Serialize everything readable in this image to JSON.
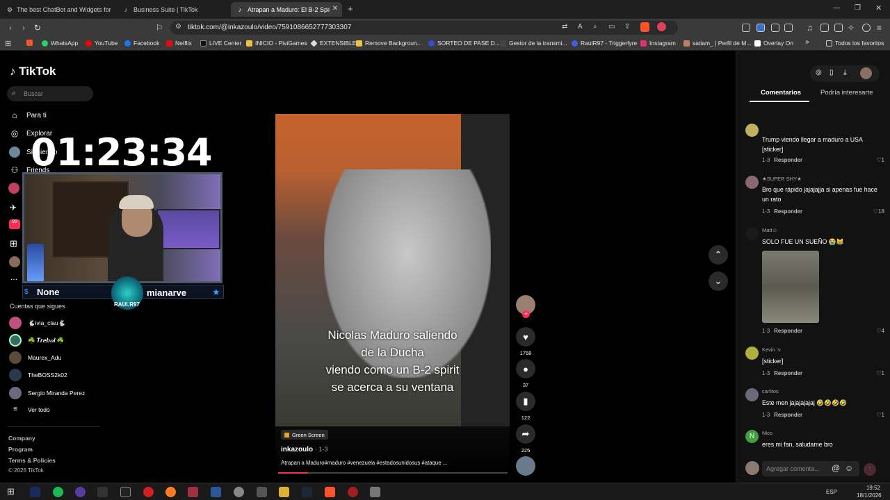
{
  "browser": {
    "tabs": [
      {
        "label": "The best ChatBot and Widgets for Ki",
        "icon": "gear-icon"
      },
      {
        "label": "Business Suite | TikTok",
        "icon": "tiktok-icon"
      },
      {
        "label": "Atrapan a Maduro: El B-2 Spirit",
        "icon": "tiktok-icon"
      }
    ],
    "new_tab": "+",
    "url": "tiktok.com/@inkazoulo/video/7591086652777303307",
    "bookmarks": [
      {
        "label": "WhatsApp",
        "color": "#25d366"
      },
      {
        "label": "YouTube",
        "color": "#ff0000"
      },
      {
        "label": "Facebook",
        "color": "#1877f2"
      },
      {
        "label": "Netflix",
        "color": "#e50914"
      },
      {
        "label": "LIVE Center",
        "color": "#111111"
      },
      {
        "label": "INICIO - PiviGames",
        "color": "#f0c040"
      },
      {
        "label": "EXTENSIBLE",
        "color": "#dddddd"
      },
      {
        "label": "Remove Backgroun...",
        "color": "#f0c040"
      },
      {
        "label": "SORTEO DE PASE D...",
        "color": "#3050d0"
      },
      {
        "label": "Gestor de la transmi...",
        "color": "#444444"
      },
      {
        "label": "RaulR97 - Triggerfyre",
        "color": "#4060e0"
      },
      {
        "label": "Instagram",
        "color": "#e1306c"
      },
      {
        "label": "satiam_ | Perfil de M...",
        "color": "#c08060"
      },
      {
        "label": "Overlay On",
        "color": "#ffffff"
      }
    ],
    "bookmarks_more": "»",
    "all_bookmarks": "Todos los favoritos"
  },
  "tiktok": {
    "logo": "TikTok",
    "search_placeholder": "Buscar",
    "nav": [
      "Para ti",
      "Explorar",
      "Siguiendo",
      "Friends"
    ],
    "nav_more": "...",
    "following_header": "Cuentas que sigues",
    "following": [
      "🐇ivia_clau🐇",
      "☘️ 𝑻𝒓𝒆𝒃𝒐𝒍 ☘️",
      "Maurex_Adu",
      "TheBOSS2k02",
      "Sergio Miranda Perez"
    ],
    "see_all": "Ver todo",
    "footer": [
      "Company",
      "Program",
      "Terms & Policies",
      "© 2026 TikTok"
    ]
  },
  "stream_overlay": {
    "timer": "01:23:34",
    "left_label": "None",
    "right_label": "mianarve",
    "emblem": "RAULR97"
  },
  "video": {
    "overlay_text": [
      "Nicolas Maduro saliendo",
      "de la Ducha",
      "viendo como un B-2 spirit",
      "se acerca a su ventana"
    ],
    "tag": "Green Screen",
    "author": "inkazoulo",
    "date": "1-3",
    "caption": "Atrapan a Maduro#maduro #venezuela #estadosunidosus #ataque ...",
    "progress": 0.13,
    "likes": "1768",
    "comments": "37",
    "saves": "122",
    "shares": "225"
  },
  "comments_panel": {
    "tab_active": "Comentarios",
    "tab_other": "Podría interesarte",
    "reply_label": "Responder",
    "comments": [
      {
        "user": "",
        "text": "Trump viendo llegar a maduro a USA [sticker]",
        "date": "1-3",
        "likes": "1"
      },
      {
        "user": "★SUPER SHY★",
        "text": "Bro que rápido jajajajja si apenas fue hace un rato",
        "date": "1-3",
        "likes": "18"
      },
      {
        "user": "Matt☺",
        "text": "SOLO FUE UN SUEÑO 😭😹",
        "date": "1-3",
        "likes": "4"
      },
      {
        "user": "Kevin :v",
        "text": "[sticker]",
        "date": "1-3",
        "likes": "1"
      },
      {
        "user": "carlitos",
        "text": "Este men jajajajajaj 🤣🤣🤣🤣",
        "date": "1-3",
        "likes": "1"
      },
      {
        "user": "Nico",
        "text": "eres mi fan, saludame bro",
        "date": "",
        "likes": ""
      }
    ],
    "input_placeholder": "Agregar comenta...",
    "at_icon": "@"
  },
  "taskbar": {
    "lang": "ESP",
    "time": "19:52",
    "date": "18/1/2026"
  }
}
